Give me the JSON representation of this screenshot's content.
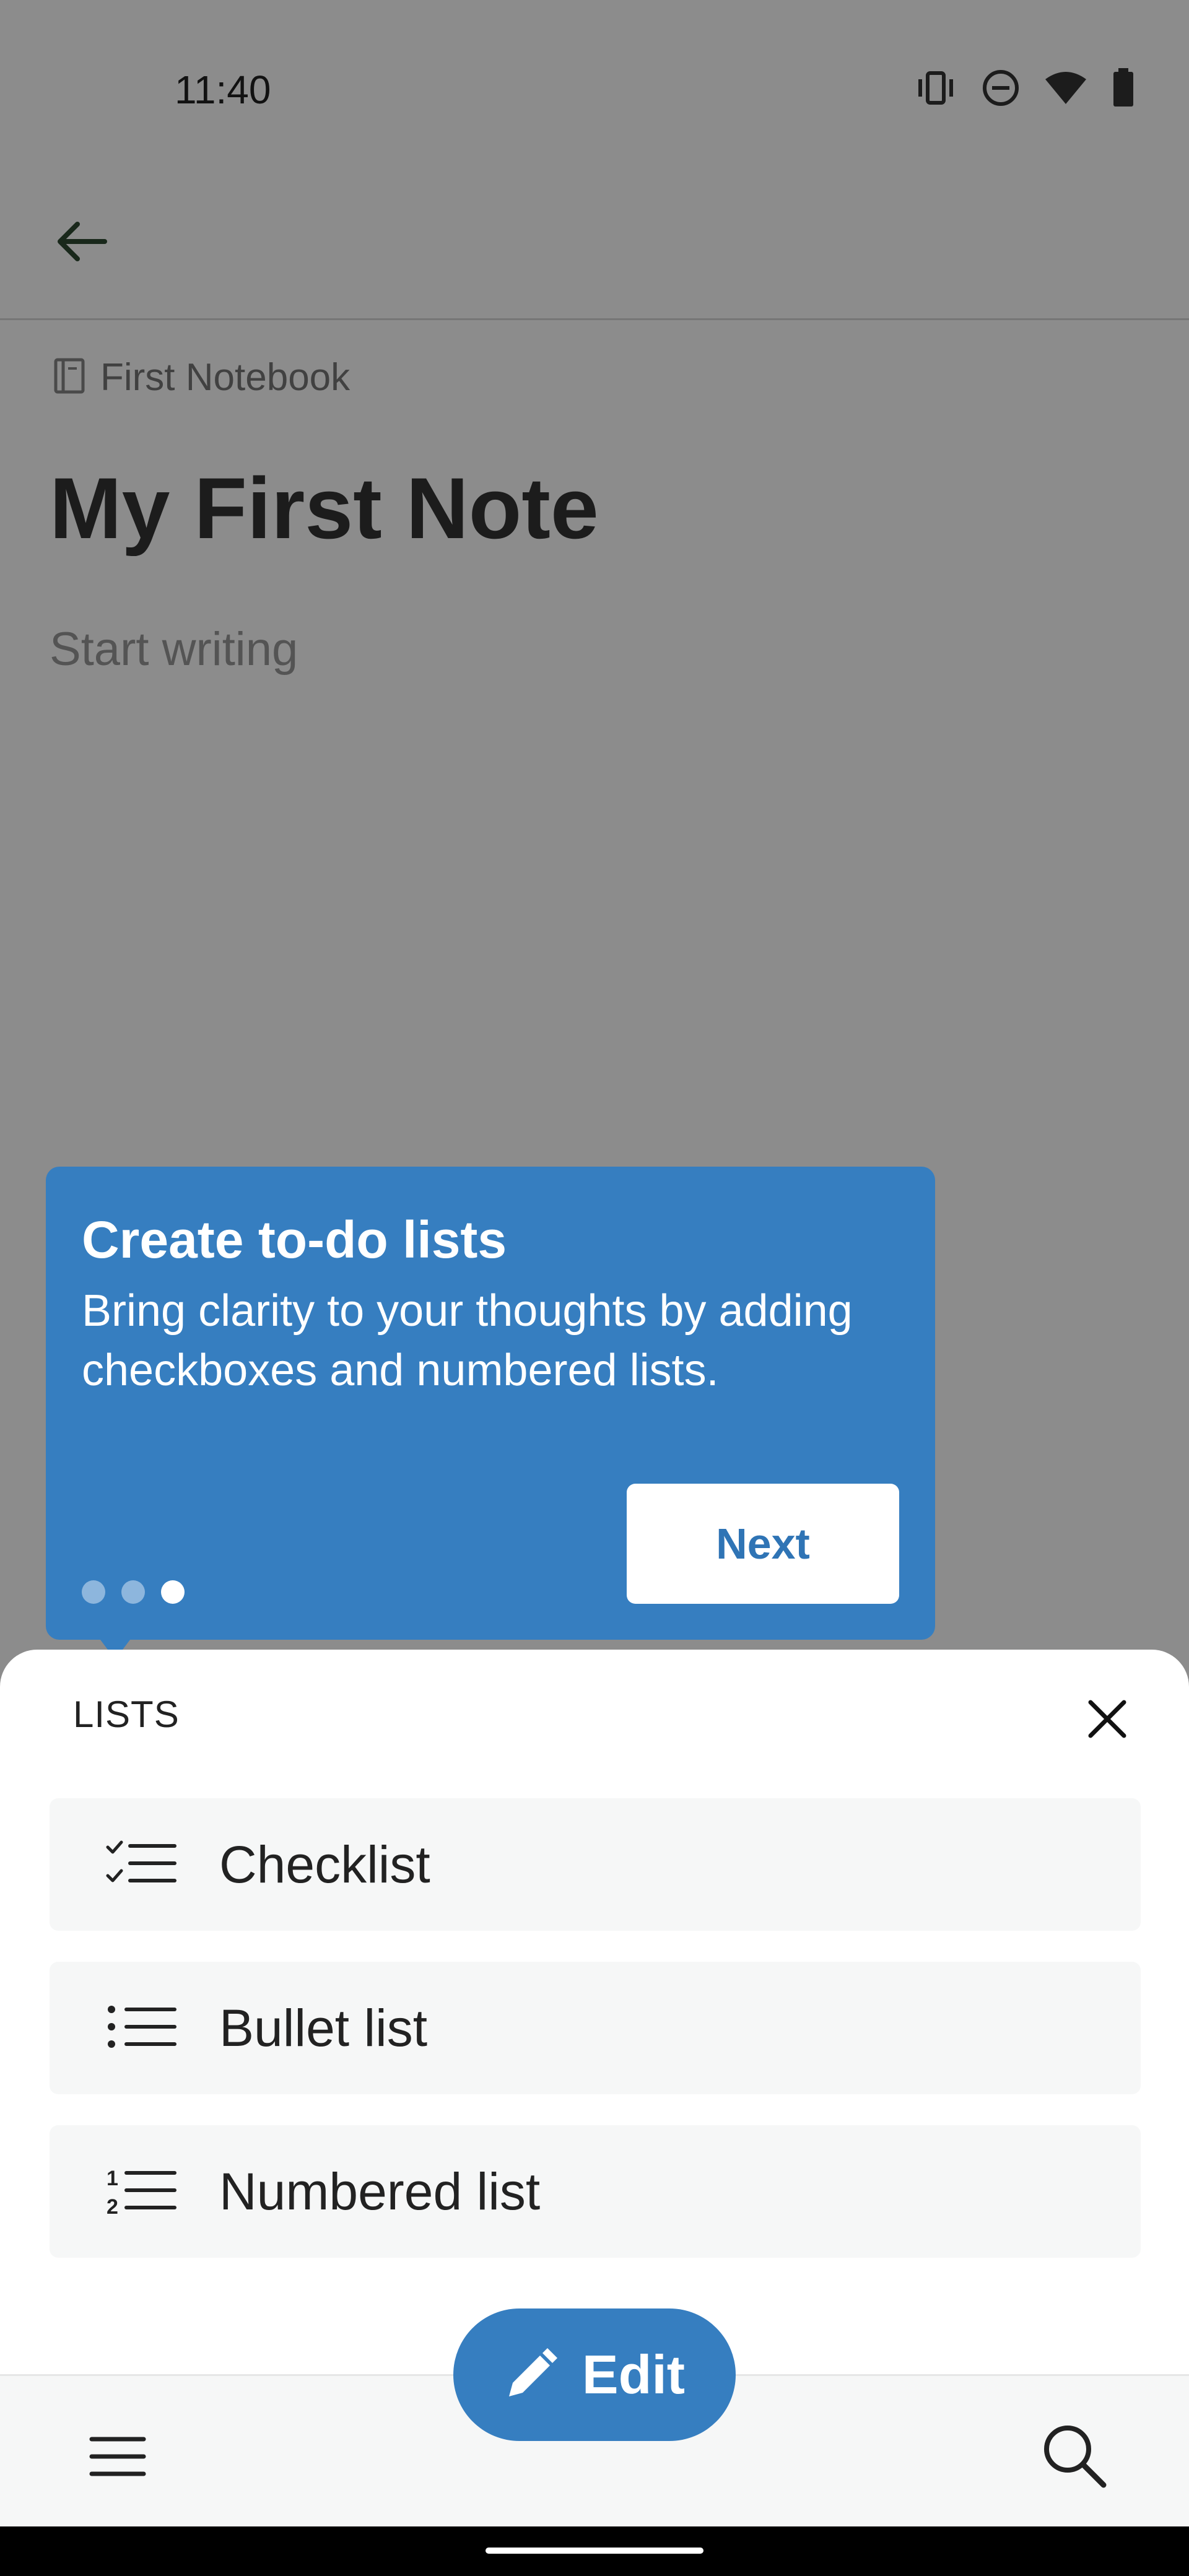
{
  "status_bar": {
    "time": "11:40",
    "icons": [
      "vibrate-icon",
      "do-not-disturb-icon",
      "wifi-icon",
      "battery-icon"
    ]
  },
  "app_bar": {
    "back_icon": "arrow-left-icon"
  },
  "note": {
    "notebook_icon": "notebook-icon",
    "notebook_name": "First Notebook",
    "title": "My First Note",
    "body_placeholder": "Start writing"
  },
  "tooltip": {
    "title": "Create to-do lists",
    "text": "Bring clarity to your thoughts by adding checkboxes and numbered lists.",
    "next_label": "Next",
    "steps_total": 3,
    "active_step": 3
  },
  "lists_sheet": {
    "title": "LISTS",
    "close_icon": "close-icon",
    "options": [
      {
        "label": "Checklist",
        "icon": "checklist-icon"
      },
      {
        "label": "Bullet list",
        "icon": "bullet-list-icon"
      },
      {
        "label": "Numbered list",
        "icon": "numbered-list-icon"
      }
    ]
  },
  "edit_button": {
    "label": "Edit",
    "icon": "pencil-icon"
  },
  "bottom_bar": {
    "menu_icon": "hamburger-menu-icon",
    "search_icon": "search-icon"
  },
  "colors": {
    "accent": "#367ec0",
    "next_text": "#2f74b5",
    "sheet_option_bg": "#f6f7f7"
  }
}
